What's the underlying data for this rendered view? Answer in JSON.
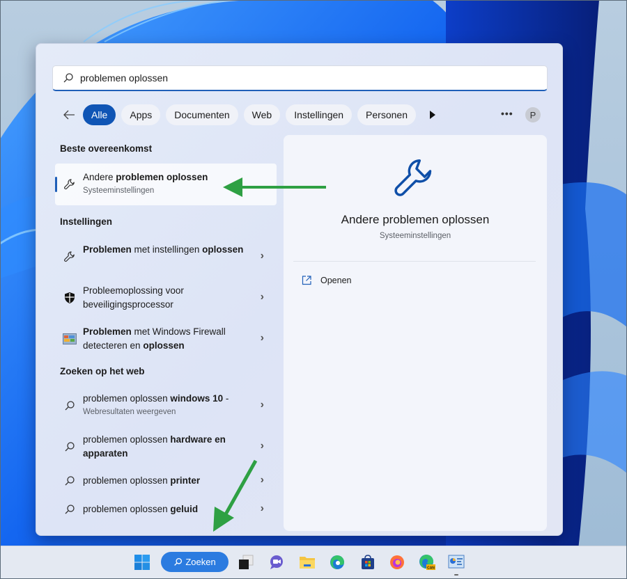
{
  "search": {
    "query": "problemen oplossen",
    "search_icon": "search-icon"
  },
  "filters": {
    "back_icon": "arrow-left-icon",
    "chips": [
      {
        "label": "Alle",
        "active": true
      },
      {
        "label": "Apps",
        "active": false
      },
      {
        "label": "Documenten",
        "active": false
      },
      {
        "label": "Web",
        "active": false
      },
      {
        "label": "Instellingen",
        "active": false
      },
      {
        "label": "Personen",
        "active": false
      }
    ],
    "more_filters_icon": "play-triangle-icon",
    "more_options": "•••",
    "avatar_initial": "P"
  },
  "sections": {
    "best_match": "Beste overeenkomst",
    "settings": "Instellingen",
    "web": "Zoeken op het web"
  },
  "best_match": {
    "title_plain": "Andere ",
    "title_bold": "problemen oplossen",
    "subtitle": "Systeeminstellingen",
    "icon": "wrench-icon"
  },
  "settings_results": [
    {
      "parts": [
        {
          "t": "Problemen",
          "b": true
        },
        {
          "t": " met instellingen ",
          "b": false
        },
        {
          "t": "oplossen",
          "b": true
        }
      ],
      "icon": "wrench-icon"
    },
    {
      "parts": [
        {
          "t": "Probleemoplossing voor beveiligingsprocessor",
          "b": false
        }
      ],
      "icon": "shield-icon"
    },
    {
      "parts": [
        {
          "t": "Problemen",
          "b": true
        },
        {
          "t": " met Windows Firewall detecteren en ",
          "b": false
        },
        {
          "t": "oplossen",
          "b": true
        }
      ],
      "icon": "firewall-icon"
    }
  ],
  "web_results": [
    {
      "plain": "problemen oplossen ",
      "bold": "windows 10",
      "suffix": " -",
      "subtitle": "Webresultaten weergeven"
    },
    {
      "plain": "problemen oplossen ",
      "bold": "hardware en apparaten",
      "suffix": "",
      "subtitle": ""
    },
    {
      "plain": "problemen oplossen ",
      "bold": "printer",
      "suffix": "",
      "subtitle": ""
    },
    {
      "plain": "problemen oplossen ",
      "bold": "geluid",
      "suffix": "",
      "subtitle": ""
    }
  ],
  "detail": {
    "title": "Andere problemen oplossen",
    "subtitle": "Systeeminstellingen",
    "icon": "wrench-icon",
    "actions": [
      {
        "label": "Openen",
        "icon": "open-external-icon"
      }
    ]
  },
  "taskbar": {
    "search_label": "Zoeken",
    "items": [
      "start-icon",
      "task-view-icon",
      "teams-chat-icon",
      "file-explorer-icon",
      "edge-icon",
      "store-icon",
      "firefox-icon",
      "edge-canary-icon",
      "control-panel-icon"
    ]
  },
  "colors": {
    "accent": "#0f55b5",
    "annotation_arrow": "#2ea043",
    "taskbar_search": "#2b7be0"
  }
}
